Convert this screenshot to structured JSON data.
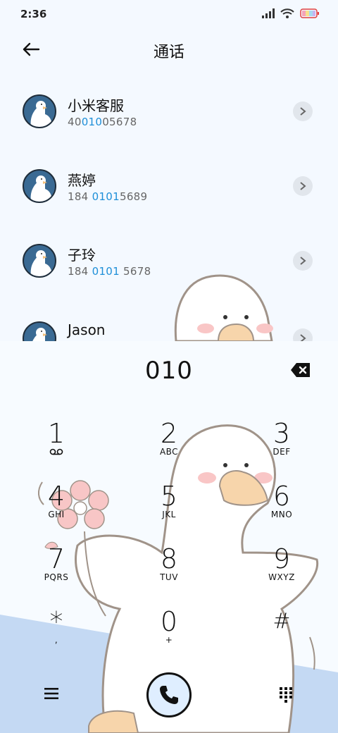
{
  "status_bar": {
    "time": "2:36"
  },
  "header": {
    "title": "通话"
  },
  "contacts": [
    {
      "name": "小米客服",
      "num_pre": "40",
      "num_hl": "010",
      "num_post": "05678"
    },
    {
      "name": "燕婷",
      "num_pre": "184 ",
      "num_hl": "0101",
      "num_post": "5689"
    },
    {
      "name": "子玲",
      "num_pre": "184 ",
      "num_hl": "0101",
      "num_post": " 5678"
    },
    {
      "name": "Jason",
      "num_pre": "",
      "num_hl": "",
      "num_post": ""
    }
  ],
  "dialer": {
    "input": "010",
    "keys": [
      {
        "digit": "1",
        "letters": ""
      },
      {
        "digit": "2",
        "letters": "ABC"
      },
      {
        "digit": "3",
        "letters": "DEF"
      },
      {
        "digit": "4",
        "letters": "GHI"
      },
      {
        "digit": "5",
        "letters": "JKL"
      },
      {
        "digit": "6",
        "letters": "MNO"
      },
      {
        "digit": "7",
        "letters": "PQRS"
      },
      {
        "digit": "8",
        "letters": "TUV"
      },
      {
        "digit": "9",
        "letters": "WXYZ"
      },
      {
        "digit": "*",
        "letters": ","
      },
      {
        "digit": "0",
        "letters": "+"
      },
      {
        "digit": "#",
        "letters": ""
      }
    ]
  },
  "colors": {
    "accent": "#1e8fd8",
    "background": "#f4f9ff",
    "call_button": "#dfeeff"
  },
  "icons": {
    "back": "arrow-left-icon",
    "backspace": "backspace-icon",
    "menu": "hamburger-menu-icon",
    "call": "phone-icon",
    "keypad": "dialpad-icon",
    "chevron": "chevron-right-icon",
    "voicemail": "voicemail-icon"
  }
}
